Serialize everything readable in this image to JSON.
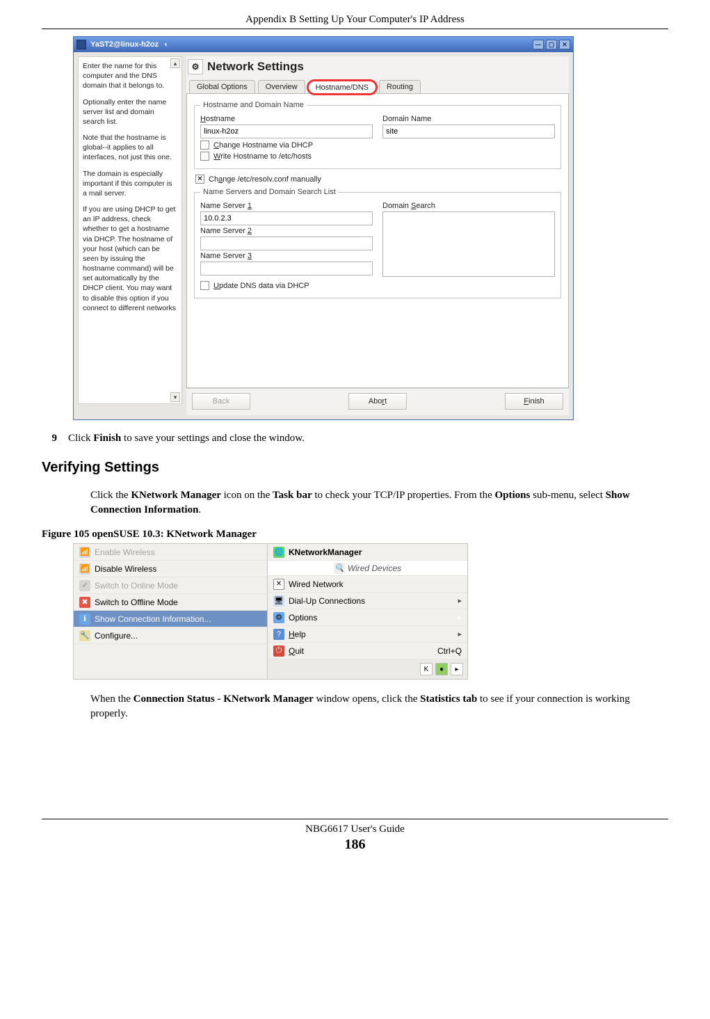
{
  "running_head": "Appendix B Setting Up Your Computer's IP Address",
  "yast": {
    "title": "YaST2@linux-h2oz",
    "heading": "Network Settings",
    "tabs": {
      "global": "Global Options",
      "overview": "Overview",
      "hostname": "Hostname/DNS",
      "routing": "Routing"
    },
    "group1": {
      "legend": "Hostname and Domain Name",
      "hostname_label": "Hostname",
      "hostname_value": "linux-h2oz",
      "domain_label": "Domain Name",
      "domain_value": "site",
      "chk_change": "Change Hostname via DHCP",
      "chk_write": "Write Hostname to /etc/hosts"
    },
    "chk_resolv": "Change /etc/resolv.conf manually",
    "group2": {
      "legend": "Name Servers and Domain Search List",
      "ns1_label": "Name Server 1",
      "ns1_value": "10.0.2.3",
      "ns2_label": "Name Server 2",
      "ns3_label": "Name Server 3",
      "search_label": "Domain Search",
      "chk_update": "Update DNS data via DHCP"
    },
    "help": {
      "p1": "Enter the name for this computer and the DNS domain that it belongs to.",
      "p2": "Optionally enter the name server list and domain search list.",
      "p3": "Note that the hostname is global--it applies to all interfaces, not just this one.",
      "p4": "The domain is especially important if this computer is a mail server.",
      "p5": "If you are using DHCP to get an IP address, check whether to get a hostname via DHCP. The hostname of your host (which can be seen by issuing the hostname command) will be set automatically by the DHCP client. You may want to disable this option if you connect to different networks"
    },
    "buttons": {
      "back": "Back",
      "abort": "Abort",
      "finish": "Finish"
    }
  },
  "step9": {
    "num": "9",
    "pre": "Click ",
    "b1": "Finish",
    "post": " to save your settings and close the window."
  },
  "verifying_heading": "Verifying Settings",
  "verify_para": {
    "t1": "Click the ",
    "b1": "KNetwork Manager",
    "t2": " icon on the ",
    "b2": "Task bar",
    "t3": " to check your TCP/IP properties. From the ",
    "b3": "Options",
    "t4": " sub-menu, select ",
    "b4": "Show Connection Information",
    "t5": "."
  },
  "figure_caption": "Figure 105   openSUSE 10.3: KNetwork Manager",
  "knm": {
    "left": {
      "enable_wireless": "Enable Wireless",
      "disable_wireless": "Disable Wireless",
      "switch_online": "Switch to Online Mode",
      "switch_offline": "Switch to Offline Mode",
      "show_conn": "Show Connection Information...",
      "configure": "Configure..."
    },
    "right": {
      "header": "KNetworkManager",
      "sub": "Wired Devices",
      "wired": "Wired Network",
      "dialup": "Dial-Up Connections",
      "options": "Options",
      "help": "Help",
      "quit": "Quit",
      "quit_shortcut": "Ctrl+Q"
    }
  },
  "after_fig": {
    "t1": "When the ",
    "b1": "Connection Status - KNetwork Manager",
    "t2": " window opens, click the ",
    "b2": "Statistics tab",
    "t3": " to see if your connection is working properly."
  },
  "footer": {
    "guide": "NBG6617 User's Guide",
    "page": "186"
  }
}
